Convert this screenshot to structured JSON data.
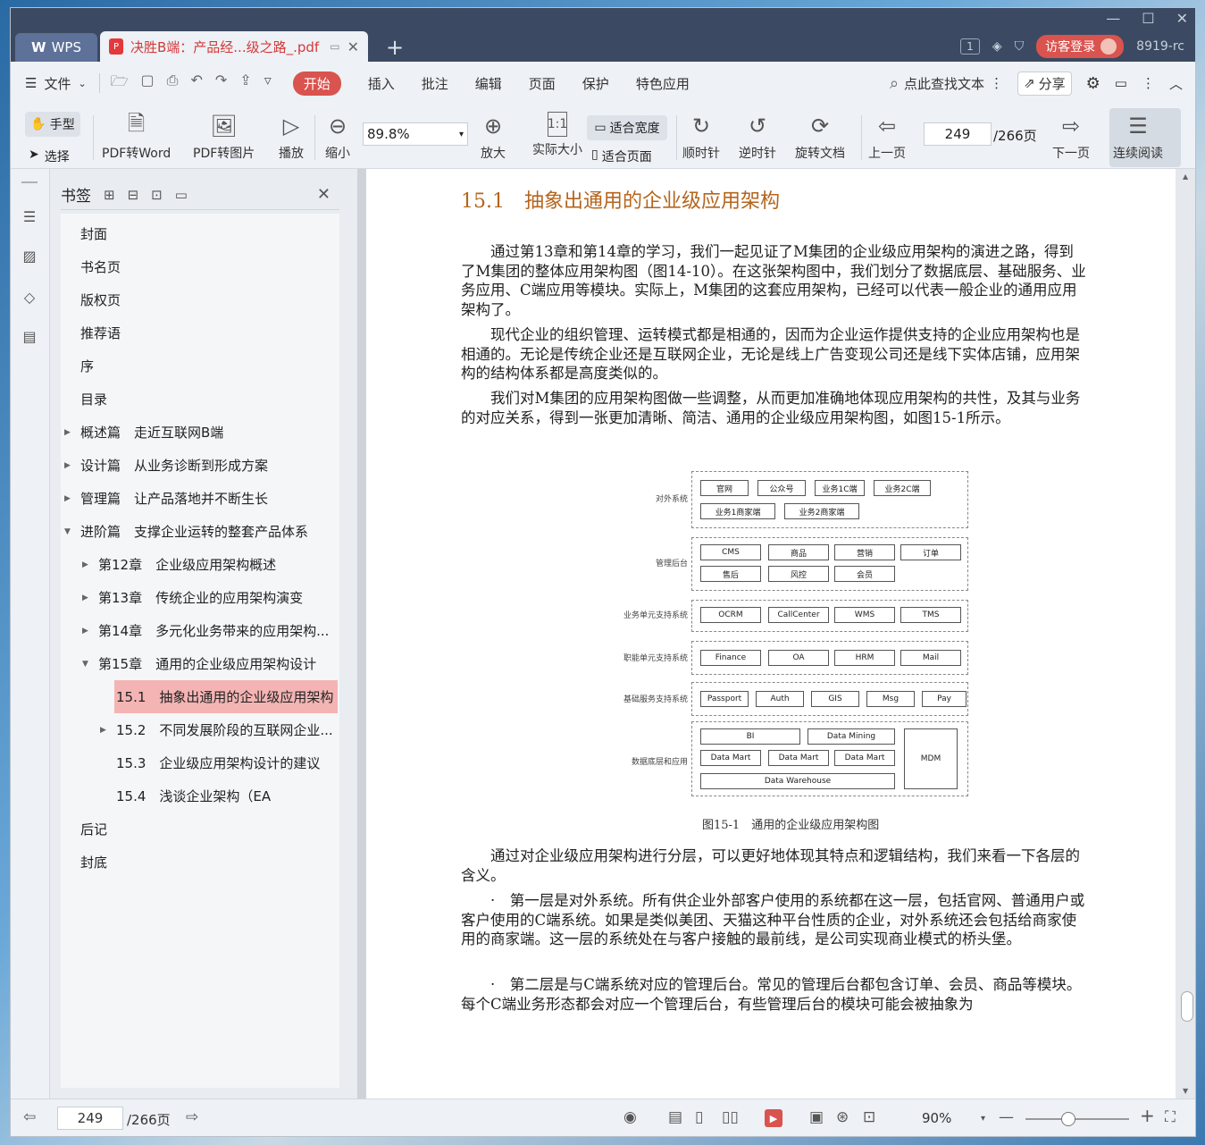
{
  "titlebar": {
    "app_tab": "WPS",
    "doc_tab": "决胜B端：产品经...级之路_.pdf",
    "page_badge": "1",
    "login": "访客登录",
    "version": "8919-rc"
  },
  "menubar": {
    "file": "文件",
    "start": "开始",
    "items": [
      "插入",
      "批注",
      "编辑",
      "页面",
      "保护",
      "特色应用"
    ],
    "search": "点此查找文本",
    "share": "分享"
  },
  "ribbon": {
    "hand": "手型",
    "select": "选择",
    "pdf2word": "PDF转Word",
    "pdf2img": "PDF转图片",
    "play": "播放",
    "zoom_out": "缩小",
    "zoom_value": "89.8%",
    "zoom_in": "放大",
    "actual": "实际大小",
    "fit_width": "适合宽度",
    "fit_page": "适合页面",
    "cw": "顺时针",
    "ccw": "逆时针",
    "rotate": "旋转文档",
    "prev": "上一页",
    "page": "249",
    "total": "/266页",
    "next": "下一页",
    "continuous": "连续阅读"
  },
  "bookmark": {
    "title": "书签",
    "items": [
      {
        "label": "封面"
      },
      {
        "label": "书名页"
      },
      {
        "label": "版权页"
      },
      {
        "label": "推荐语"
      },
      {
        "label": "序"
      },
      {
        "label": "目录"
      },
      {
        "label": "概述篇　走近互联网B端"
      },
      {
        "label": "设计篇　从业务诊断到形成方案"
      },
      {
        "label": "管理篇　让产品落地并不断生长"
      },
      {
        "label": "进阶篇　支撑企业运转的整套产品体系"
      },
      {
        "label": "第12章　企业级应用架构概述"
      },
      {
        "label": "第13章　传统企业的应用架构演变"
      },
      {
        "label": "第14章　多元化业务带来的应用架构..."
      },
      {
        "label": "第15章　通用的企业级应用架构设计"
      },
      {
        "label": "15.1　抽象出通用的企业级应用架构"
      },
      {
        "label": "15.2　不同发展阶段的互联网企业..."
      },
      {
        "label": "15.3　企业级应用架构设计的建议"
      },
      {
        "label": "15.4　浅谈企业架构（EA"
      },
      {
        "label": "后记"
      },
      {
        "label": "封底"
      }
    ]
  },
  "doc": {
    "heading": "15.1　抽象出通用的企业级应用架构",
    "p1": "通过第13章和第14章的学习，我们一起见证了M集团的企业级应用架构的演进之路，得到了M集团的整体应用架构图（图14-10）。在这张架构图中，我们划分了数据底层、基础服务、业务应用、C端应用等模块。实际上，M集团的这套应用架构，已经可以代表一般企业的通用应用架构了。",
    "p2": "现代企业的组织管理、运转模式都是相通的，因而为企业运作提供支持的企业应用架构也是相通的。无论是传统企业还是互联网企业，无论是线上广告变现公司还是线下实体店铺，应用架构的结构体系都是高度类似的。",
    "p3": "我们对M集团的应用架构图做一些调整，从而更加准确地体现应用架构的共性，及其与业务的对应关系，得到一张更加清晰、简洁、通用的企业级应用架构图，如图15-1所示。",
    "caption": "图15-1　通用的企业级应用架构图",
    "p4": "通过对企业级应用架构进行分层，可以更好地体现其特点和逻辑结构，我们来看一下各层的含义。",
    "p5": "·　第一层是对外系统。所有供企业外部客户使用的系统都在这一层，包括官网、普通用户或客户使用的C端系统。如果是类似美团、天猫这种平台性质的企业，对外系统还会包括给商家使用的商家端。这一层的系统处在与客户接触的最前线，是公司实现商业模式的桥头堡。",
    "p6": "·　第二层是与C端系统对应的管理后台。常见的管理后台都包含订单、会员、商品等模块。每个C端业务形态都会对应一个管理后台，有些管理后台的模块可能会被抽象为"
  },
  "figure": {
    "layers": [
      {
        "label": "对外系统",
        "boxes": [
          "官网",
          "公众号",
          "业务1C端",
          "业务2C端",
          "业务1商家端",
          "业务2商家端"
        ]
      },
      {
        "label": "管理后台",
        "boxes": [
          "CMS",
          "商品",
          "营销",
          "订单",
          "售后",
          "风控",
          "会员"
        ]
      },
      {
        "label": "业务单元支持系统",
        "boxes": [
          "OCRM",
          "CallCenter",
          "WMS",
          "TMS"
        ]
      },
      {
        "label": "职能单元支持系统",
        "boxes": [
          "Finance",
          "OA",
          "HRM",
          "Mail"
        ]
      },
      {
        "label": "基础服务支持系统",
        "boxes": [
          "Passport",
          "Auth",
          "GIS",
          "Msg",
          "Pay"
        ]
      },
      {
        "label": "数据底层和应用",
        "boxes": [
          "BI",
          "Data Mining",
          "Data Mart",
          "Data Mart",
          "Data Mart",
          "Data Warehouse",
          "MDM"
        ]
      }
    ]
  },
  "status": {
    "page": "249",
    "total": "/266页",
    "zoom": "90%"
  }
}
